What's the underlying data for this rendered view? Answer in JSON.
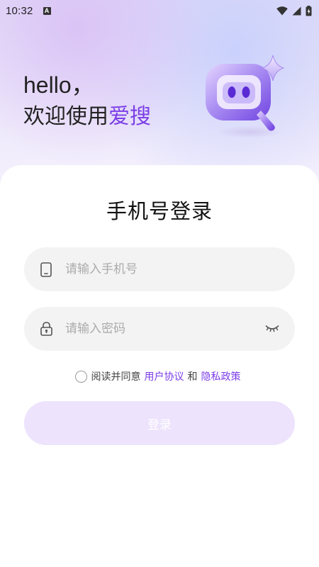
{
  "status_bar": {
    "time": "10:32",
    "indicator": "A",
    "icons": [
      "wifi-icon",
      "signal-icon",
      "battery-charging-icon"
    ]
  },
  "header": {
    "greeting": "hello，",
    "welcome_prefix": "欢迎使用",
    "brand_name": "爱搜",
    "brand_color": "#7b3ee6",
    "mascot_icon": "app-mascot-icon"
  },
  "login": {
    "title": "手机号登录",
    "phone_placeholder": "请输入手机号",
    "phone_value": "",
    "password_placeholder": "请输入密码",
    "password_value": "",
    "agreement_prefix": "阅读并同意",
    "user_agreement": "用户协议",
    "and": "和",
    "privacy_policy": "隐私政策",
    "agree_checked": false,
    "submit_label": "登录",
    "submit_bg": "#ede3fc"
  }
}
